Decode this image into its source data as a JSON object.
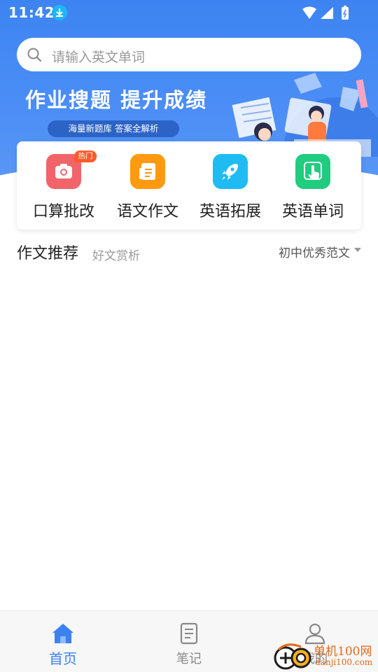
{
  "status_bar": {
    "time": "11:42"
  },
  "search": {
    "placeholder": "请输入英文单词"
  },
  "banner": {
    "title": "作业搜题 提升成绩",
    "pill": "海量新题库  答案全解析"
  },
  "quick_tools": [
    {
      "label": "口算批改",
      "color": "#f0646a",
      "icon": "camera-icon",
      "badge": "热门"
    },
    {
      "label": "语文作文",
      "color": "#ff9a10",
      "icon": "document-icon"
    },
    {
      "label": "英语拓展",
      "color": "#1ebcf3",
      "icon": "rocket-icon"
    },
    {
      "label": "英语单词",
      "color": "#20cc7f",
      "icon": "tap-icon"
    }
  ],
  "section": {
    "title": "作文推荐",
    "subtitle": "好文赏析",
    "filter": "初中优秀范文"
  },
  "bottom_nav": [
    {
      "label": "首页",
      "icon": "home-icon",
      "active": true
    },
    {
      "label": "笔记",
      "icon": "notes-icon",
      "active": false
    },
    {
      "label": "我的",
      "icon": "user-icon",
      "active": false
    }
  ],
  "watermark": {
    "text": "单机100网",
    "url": "danji100.com"
  },
  "colors": {
    "primary": "#3b82f0",
    "header": "#4c8ef6"
  }
}
